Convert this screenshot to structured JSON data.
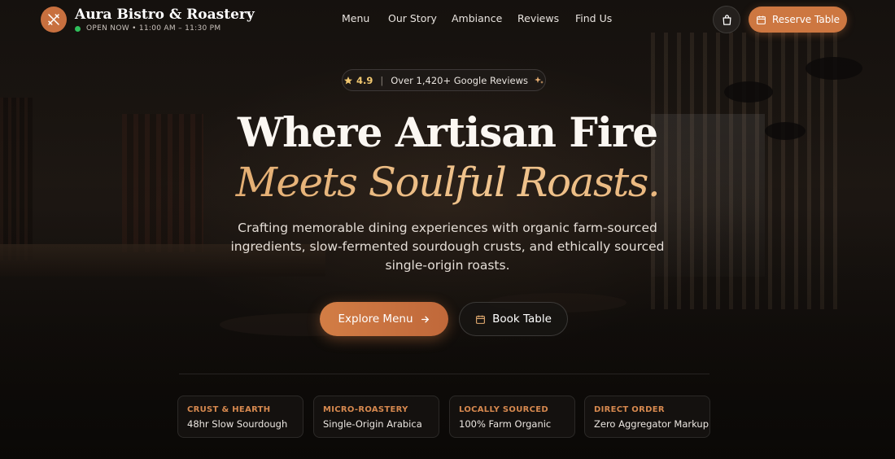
{
  "brand": {
    "name": "Aura Bistro & Roastery",
    "status": "OPEN NOW • 11:00 AM – 11:30 PM",
    "status_color": "#2fbf5b",
    "logo_icon": "utensils-icon",
    "logo_color": "#c8703f"
  },
  "nav": {
    "items": [
      {
        "label": "Menu"
      },
      {
        "label": "Our Story"
      },
      {
        "label": "Ambiance"
      },
      {
        "label": "Reviews"
      },
      {
        "label": "Find Us"
      }
    ],
    "cart_icon": "shopping-bag-icon",
    "reserve_label": "Reserve Table",
    "reserve_icon": "calendar-icon"
  },
  "hero": {
    "rating_score": "4.9",
    "rating_separator": "|",
    "rating_reviews": "Over 1,420+ Google Reviews",
    "rating_icons": [
      "star-icon",
      "sparkles-icon"
    ],
    "title_line1": "Where Artisan Fire",
    "title_line2": "Meets Soulful Roasts.",
    "subtitle": "Crafting memorable dining experiences with organic farm-sourced ingredients, slow-fermented sourdough crusts, and ethically sourced single-origin roasts.",
    "primary_cta": "Explore Menu",
    "primary_cta_icon": "arrow-right-icon",
    "secondary_cta": "Book Table",
    "secondary_cta_icon": "calendar-icon"
  },
  "features": [
    {
      "label": "CRUST & HEARTH",
      "value": "48hr Slow Sourdough"
    },
    {
      "label": "MICRO-ROASTERY",
      "value": "Single-Origin Arabica"
    },
    {
      "label": "LOCALLY SOURCED",
      "value": "100% Farm Organic"
    },
    {
      "label": "DIRECT ORDER",
      "value": "Zero Aggregator Markup"
    }
  ],
  "colors": {
    "accent": "#cd7741",
    "accent_gold": "#e7ae72",
    "background": "#14100d",
    "star": "#f1c870"
  }
}
